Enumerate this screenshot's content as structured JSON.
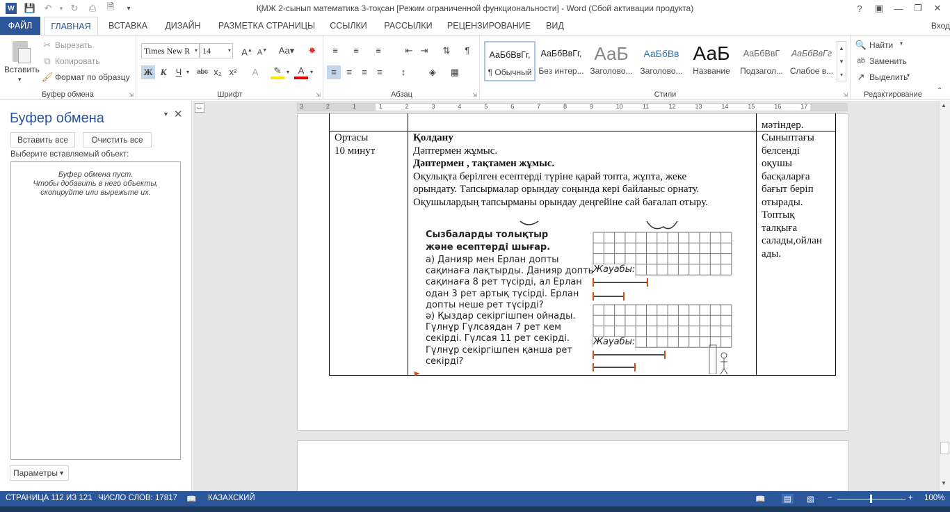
{
  "window": {
    "title": "ҚМЖ 2-сынып  математика 3-тоқсан [Режим ограниченной функциональности] - Word (Сбой активации продукта)",
    "login": "Вход"
  },
  "tabs": [
    "ФАЙЛ",
    "ГЛАВНАЯ",
    "ВСТАВКА",
    "ДИЗАЙН",
    "РАЗМЕТКА СТРАНИЦЫ",
    "ССЫЛКИ",
    "РАССЫЛКИ",
    "РЕЦЕНЗИРОВАНИЕ",
    "ВИД"
  ],
  "ribbon": {
    "clipboard": {
      "paste": "Вставить",
      "cut": "Вырезать",
      "copy": "Копировать",
      "format_painter": "Формат по образцу",
      "label": "Буфер обмена"
    },
    "font": {
      "name": "Times New R",
      "size": "14",
      "bold": "Ж",
      "italic": "К",
      "underline": "Ч",
      "strike": "abc",
      "sub": "x₂",
      "sup": "x²",
      "label": "Шрифт"
    },
    "paragraph": {
      "label": "Абзац"
    },
    "styles": {
      "label": "Стили",
      "items": [
        {
          "sample": "АаБбВвГг,",
          "name": "¶ Обычный"
        },
        {
          "sample": "АаБбВвГг,",
          "name": "Без интер..."
        },
        {
          "sample": "АаБ",
          "name": "Заголово..."
        },
        {
          "sample": "АаБбВв",
          "name": "Заголово..."
        },
        {
          "sample": "АаБ",
          "name": "Название"
        },
        {
          "sample": "АаБбВвГ",
          "name": "Подзагол..."
        },
        {
          "sample": "АаБбВвГг",
          "name": "Слабое в..."
        }
      ]
    },
    "editing": {
      "find": "Найти",
      "replace": "Заменить",
      "select": "Выделить",
      "label": "Редактирование"
    }
  },
  "clipboard_pane": {
    "title": "Буфер обмена",
    "paste_all": "Вставить все",
    "clear_all": "Очистить все",
    "prompt": "Выберите вставляемый объект:",
    "empty_line1": "Буфер обмена пуст.",
    "empty_line2": "Чтобы добавить в него объекты,",
    "empty_line3": "скопируйте или вырежьте их.",
    "options": "Параметры"
  },
  "ruler": {
    "labels": [
      "3",
      "2",
      "1",
      "1",
      "2",
      "3",
      "4",
      "5",
      "6",
      "7",
      "8",
      "9",
      "10",
      "11",
      "12",
      "13",
      "14",
      "15",
      "16",
      "17"
    ]
  },
  "document": {
    "prev_row_tail": "мәтіндер.",
    "stage_line1": "Ортасы",
    "stage_line2": "10 минут",
    "heading": "Қолдану",
    "line1": "Дәптермен жұмыс.",
    "line2": "Дәптермен , тақтамен жұмыс.",
    "line3": "Оқулықта берілген есептерді түріне қарай топта, жұпта, жеке",
    "line4": "орындату. Тапсырмалар орындау соңында кері байланыс орнату.",
    "line5": "Оқушылардың тапсырманы орындау деңгейіне  сай бағалап отыру.",
    "right_col": [
      "Сыныптағы",
      "белсенді",
      "оқушы",
      "басқаларға",
      "бағыт беріп",
      "отырады.",
      "Топтық",
      "талқыға",
      "салады,ойлан",
      "ады."
    ]
  },
  "figure": {
    "title1": "Сызбаларды толықтыр",
    "title2": "және есептерді шығар.",
    "a_lines": [
      "а) Данияр мен Ерлан допты",
      "сақинаға лақтырды. Данияр допты",
      "сақинаға 8 рет түсірді, ал Ерлан",
      "одан 3 рет артық түсірді. Ерлан",
      "допты  неше рет түсірді?"
    ],
    "b_lines": [
      "ә) Қыздар секіргішпен ойнады.",
      "Гүлнұр Гүлсаядан 7 рет кем",
      "секірді. Гүлсая 11 рет секірді.",
      "Гүлнұр секіргішпен қанша рет",
      "секірді?"
    ],
    "answer_label": "Жауабы:"
  },
  "statusbar": {
    "page": "СТРАНИЦА 112 ИЗ 121",
    "words": "ЧИСЛО СЛОВ: 17817",
    "language": "КАЗАХСКИЙ",
    "zoom": "100%"
  },
  "colors": {
    "accent": "#2b579a",
    "segment": "#c8501e"
  }
}
